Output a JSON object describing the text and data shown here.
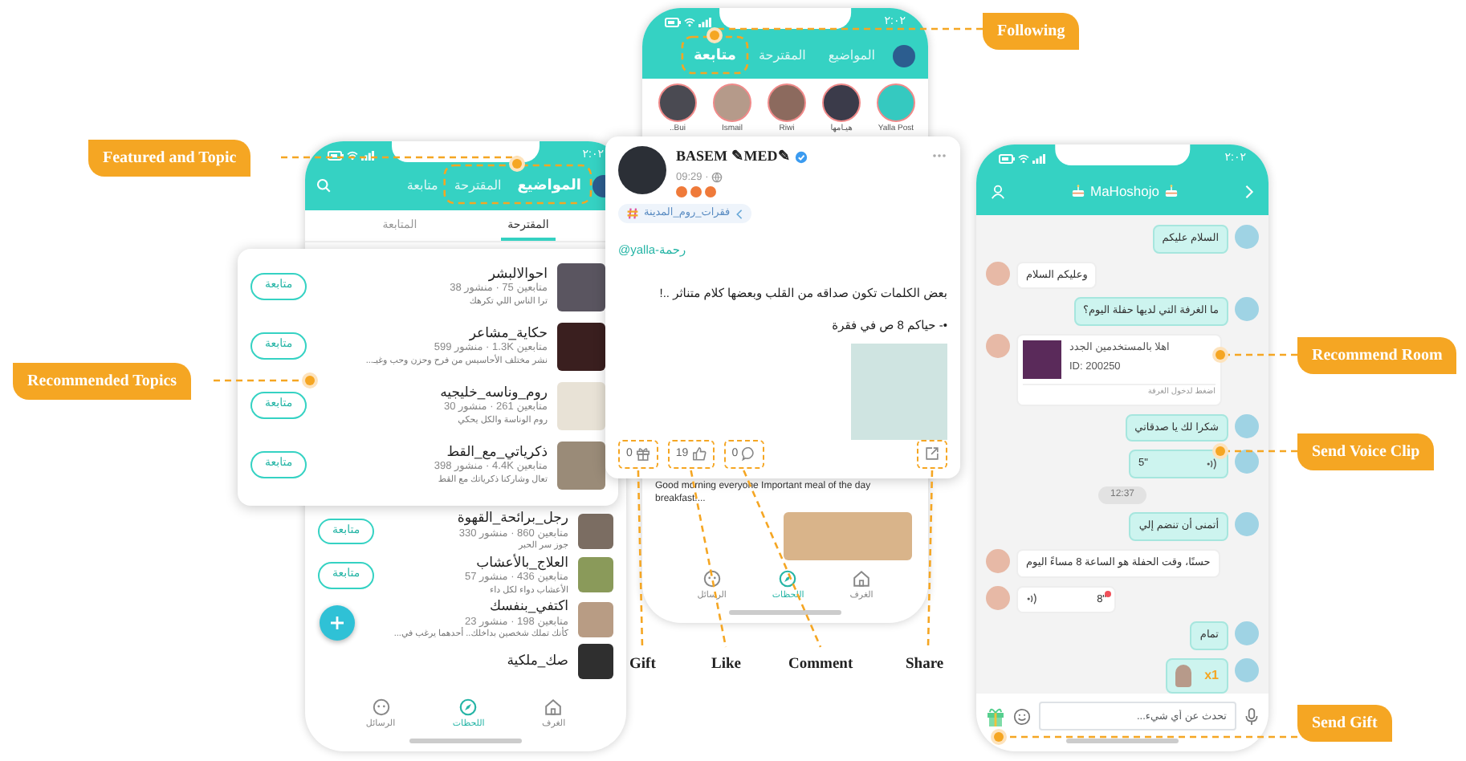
{
  "callouts": [
    {
      "text": "Featured and Topic"
    },
    {
      "text": "Recommended Topics"
    },
    {
      "text": "Following"
    },
    {
      "text": "Recommend Room"
    },
    {
      "text": "Send Voice Clip"
    },
    {
      "text": "Send Gift"
    }
  ],
  "action_labels": {
    "gift": "Gift",
    "like": "Like",
    "comment": "Comment",
    "share": "Share"
  },
  "topics_screen": {
    "status_time": "٢:٠٢",
    "tabs": [
      {
        "label": "المواضيع",
        "selected": true
      },
      {
        "label": "المقترحة",
        "selected": false
      },
      {
        "label": "متابعة",
        "selected": false
      }
    ],
    "sub_tabs": [
      {
        "label": "المقترحة",
        "selected": true
      },
      {
        "label": "المتابعة",
        "selected": false
      }
    ],
    "featured_topics": [
      {
        "name": "احوالالبشر",
        "stats": "متابعين 75 · منشور 38",
        "description": "ترا الناس اللي تكرهك",
        "button": "متابعة"
      },
      {
        "name": "حكاية_مشاعر",
        "stats": "متابعين 1.3K · منشور 599",
        "description": "نشر مختلف الأحاسيس من فرح وحزن وحب وغيـ...",
        "button": "متابعة"
      },
      {
        "name": "روم_وناسه_خليجيه",
        "stats": "متابعين 261 · منشور 30",
        "description": "روم الوناسة والكل يحكي",
        "button": "متابعة"
      },
      {
        "name": "ذكرياتي_مع_القط",
        "stats": "متابعين 4.4K · منشور 398",
        "description": "تعال وشاركنا ذكرياتك مع القط",
        "button": "متابعة"
      }
    ],
    "topics": [
      {
        "name": "رجل_برائحة_القهوة",
        "stats": "متابعين 860 · منشور 330",
        "description": "جوز سر الحبر",
        "button": "متابعة"
      },
      {
        "name": "العلاج_بالأعشاب",
        "stats": "متابعين 436 · منشور 57",
        "description": "الأعشاب دواء لكل داء",
        "button": "متابعة"
      },
      {
        "name": "اكتفي_بنفسك",
        "stats": "متابعين 198 · منشور 23",
        "description": "كأنك تملك شخصين بداخلك.. أحدهما يرغب في..."
      },
      {
        "name": "صك_ملكية"
      }
    ],
    "bottom_nav": [
      {
        "label": "الغرف",
        "selected": false
      },
      {
        "label": "اللحظات",
        "selected": true
      },
      {
        "label": "الرسائل",
        "selected": false
      }
    ]
  },
  "feed_screen": {
    "status_time": "٢:٠٢",
    "tabs": [
      {
        "label": "المواضيع",
        "selected": false
      },
      {
        "label": "المقترحة",
        "selected": false
      },
      {
        "label": "متابعة",
        "selected": true
      }
    ],
    "stories": [
      {
        "name": "Yalla Post"
      },
      {
        "name": "هيـامها"
      },
      {
        "name": "Riwi"
      },
      {
        "name": "Ismail"
      },
      {
        "name": "Bui.."
      }
    ],
    "post": {
      "author": "BASEM ✎MED✎",
      "time": "09:29 ·",
      "topic": "فقرات_روم_المدينة",
      "mention": "@yalla-رحمة",
      "lines": [
        "بعض الكلمات تكون صداقه من القلب وبعضها كلام متناثر ..!",
        "•- حياكم 8 ص في فقرة"
      ],
      "gifts": "0",
      "likes": "19",
      "comments": "0"
    },
    "next_post_text": "Good morning everyone Important meal of the day breakfast!...",
    "bottom_nav": [
      {
        "label": "الغرف",
        "selected": false
      },
      {
        "label": "اللحظات",
        "selected": true
      },
      {
        "label": "الرسائل",
        "selected": false
      }
    ]
  },
  "chat_screen": {
    "status_time": "٢:٠٢",
    "title": "MaHoshojo",
    "messages": [
      {
        "kind": "text",
        "mine": true,
        "text": "السلام عليكم"
      },
      {
        "kind": "text",
        "mine": false,
        "text": "وعليكم السلام"
      },
      {
        "kind": "text",
        "mine": true,
        "text": "ما الغرفة التي لديها حفلة اليوم؟"
      },
      {
        "kind": "room",
        "mine": false,
        "title": "اهلا بالمستخدمين الجدد",
        "room_id": "ID: 200250",
        "hint": "اضغط لدخول الغرفة"
      },
      {
        "kind": "text",
        "mine": true,
        "text": "شكرا لك يا صدقاتي"
      },
      {
        "kind": "voice",
        "mine": true,
        "duration": "5\"",
        "unread": false
      },
      {
        "kind": "time",
        "text": "12:37"
      },
      {
        "kind": "text",
        "mine": true,
        "text": "أتمنى أن تنضم إلي"
      },
      {
        "kind": "text",
        "mine": false,
        "text": "حسنًا، وقت الحفلة هو الساعة 8 مساءً اليوم"
      },
      {
        "kind": "voice",
        "mine": false,
        "duration": "8\"",
        "unread": true
      },
      {
        "kind": "text",
        "mine": true,
        "text": "تمام"
      },
      {
        "kind": "gift",
        "mine": true,
        "count": "x1"
      }
    ],
    "input": {
      "placeholder": "تحدث عن أي شيء..."
    }
  }
}
